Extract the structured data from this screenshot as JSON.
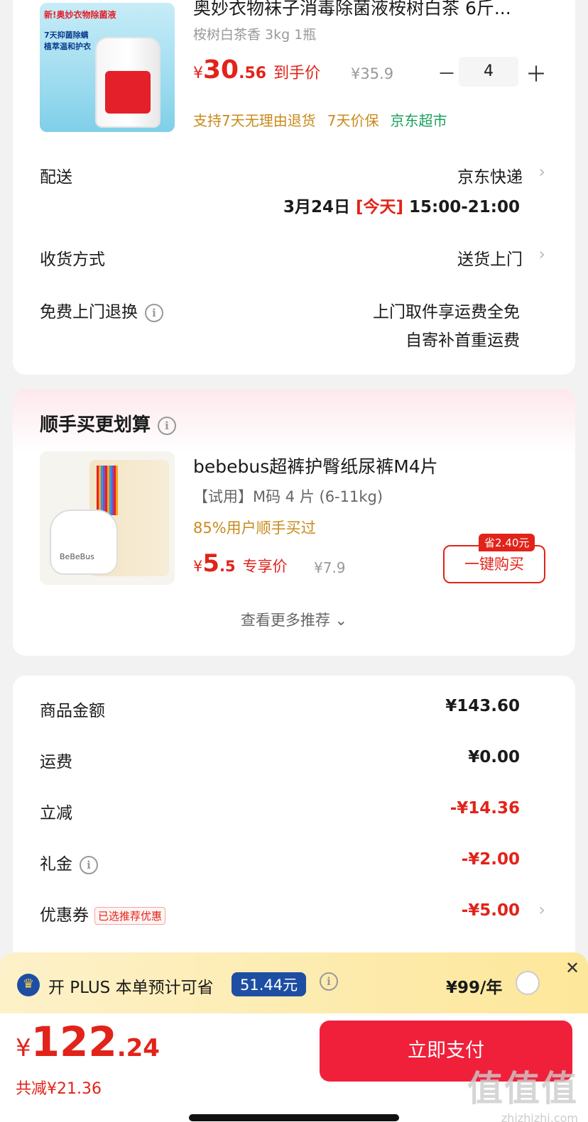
{
  "product": {
    "title": "奥妙衣物袜子消毒除菌液桉树白茶 6斤...",
    "spec": "桉树白茶香 3kg 1瓶",
    "price_currency": "¥",
    "price_int": "30",
    "price_dec": ".56",
    "price_label": "到手价",
    "original_price": "¥35.9",
    "qty_minus": "－",
    "quantity": "4",
    "qty_plus": "＋",
    "image_tag": "新!奥妙衣物除菌液",
    "image_banner": "7天抑菌除螨 植萃温和护衣",
    "tags": [
      {
        "text": "支持7天无理由退货",
        "color": "#c98a1b"
      },
      {
        "text": "7天价保",
        "color": "#c98a1b"
      },
      {
        "text": "京东超市",
        "color": "#19a05c"
      }
    ]
  },
  "delivery": {
    "label": "配送",
    "carrier": "京东快递",
    "date": "3月24日",
    "today": "[今天]",
    "time": "15:00-21:00"
  },
  "receive": {
    "label": "收货方式",
    "value": "送货上门"
  },
  "free_return": {
    "label": "免费上门退换",
    "line1": "上门取件享运费全免",
    "line2": "自寄补首重运费"
  },
  "recommend": {
    "title": "顺手买更划算",
    "name": "bebebus超裤护臀纸尿裤M4片",
    "spec": "【试用】M码 4 片 (6-11kg)",
    "stat": "85%用户顺手买过",
    "price_currency": "¥",
    "price_int": "5",
    "price_dec": ".5",
    "price_label": "专享价",
    "original_price": "¥7.9",
    "save_badge": "省2.40元",
    "buy_label": "一键购买",
    "more_label": "查看更多推荐 ⌄",
    "image_brand": "BeBeBus"
  },
  "summary": {
    "rows": [
      {
        "label": "商品金额",
        "value": "¥143.60"
      },
      {
        "label": "运费",
        "value": "¥0.00"
      },
      {
        "label": "立减",
        "value": "-¥14.36"
      },
      {
        "label": "礼金",
        "value": "-¥2.00"
      },
      {
        "label": "优惠券",
        "value": "-¥5.00",
        "tag": "已选推荐优惠"
      }
    ]
  },
  "plus": {
    "text": "开 PLUS 本单预计可省",
    "amount": "51.44元",
    "price": "¥99/年",
    "crown": "♛",
    "close": "✕"
  },
  "checkout": {
    "currency": "¥",
    "total_int": "122",
    "total_dec": ".24",
    "saved": "共减¥21.36",
    "pay_label": "立即支付"
  },
  "watermark": {
    "big": "值值值",
    "small": "zhizhizhi.com"
  },
  "colors": {
    "accent_red": "#e2231a",
    "pay_button": "#f0203b",
    "plus_blue": "#1d4ea3",
    "tag_gold": "#c98a1b",
    "tag_green": "#19a05c"
  }
}
